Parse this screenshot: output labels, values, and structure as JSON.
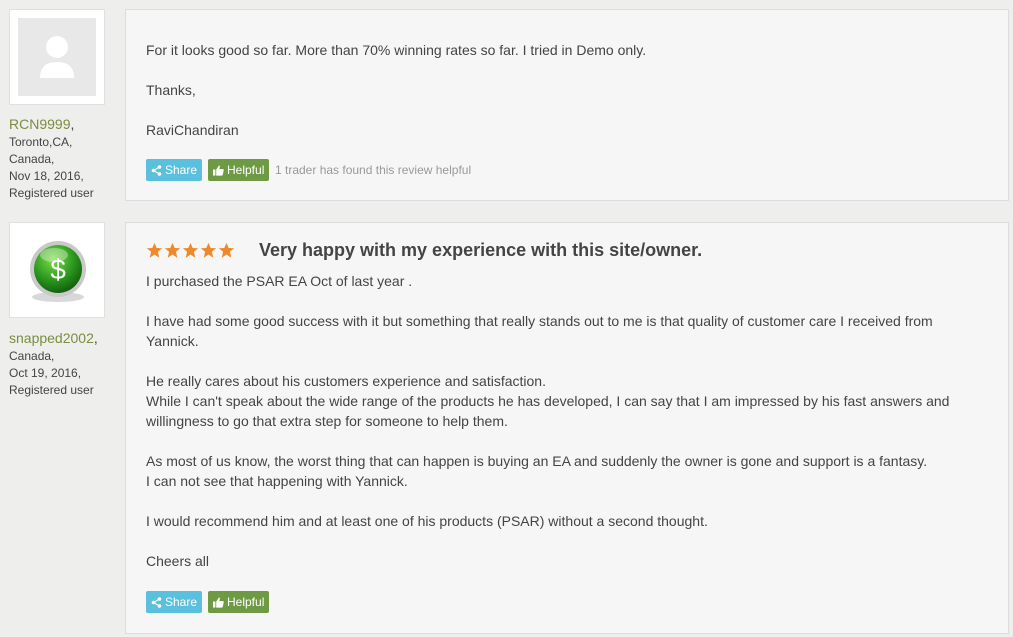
{
  "reviews": [
    {
      "user": {
        "username": "RCN9999",
        "location_lines": [
          "Toronto,CA,",
          "Canada,"
        ],
        "date": "Nov 18, 2016,",
        "role": "Registered user",
        "avatar": "person-icon"
      },
      "paragraphs": [
        "For it looks good so far. More than 70% winning rates so far. I tried in Demo only.",
        "Thanks,",
        "RaviChandiran"
      ],
      "share_label": "Share",
      "helpful_label": "Helpful",
      "helpful_note": "1 trader has found this review helpful"
    },
    {
      "user": {
        "username": "snapped2002",
        "location_lines": [
          "Canada,"
        ],
        "date": "Oct 19, 2016,",
        "role": "Registered user",
        "avatar": "dollar-icon"
      },
      "rating": 5,
      "title": "Very happy with my experience with this site/owner.",
      "paragraphs": [
        "I purchased the PSAR EA Oct of last year .",
        "I have had some good success with it but something that really stands out to me is that quality of customer care I received from Yannick.",
        "He really cares about his customers experience and satisfaction.\nWhile I can't speak about the wide range of the products he has developed, I can say that I am impressed by his fast answers and willingness to go that extra step for someone to help them.",
        "As most of us know, the worst thing that can happen is buying an EA and suddenly the owner is gone and support is a fantasy.\nI can not see that happening with Yannick.",
        "I would recommend him and at least one of his products (PSAR) without a second thought.",
        "Cheers all"
      ],
      "share_label": "Share",
      "helpful_label": "Helpful"
    }
  ],
  "colors": {
    "username": "#7a8d3f",
    "share_button": "#5bc0de",
    "helpful_button": "#6e9a43",
    "star": "#f0892b"
  }
}
